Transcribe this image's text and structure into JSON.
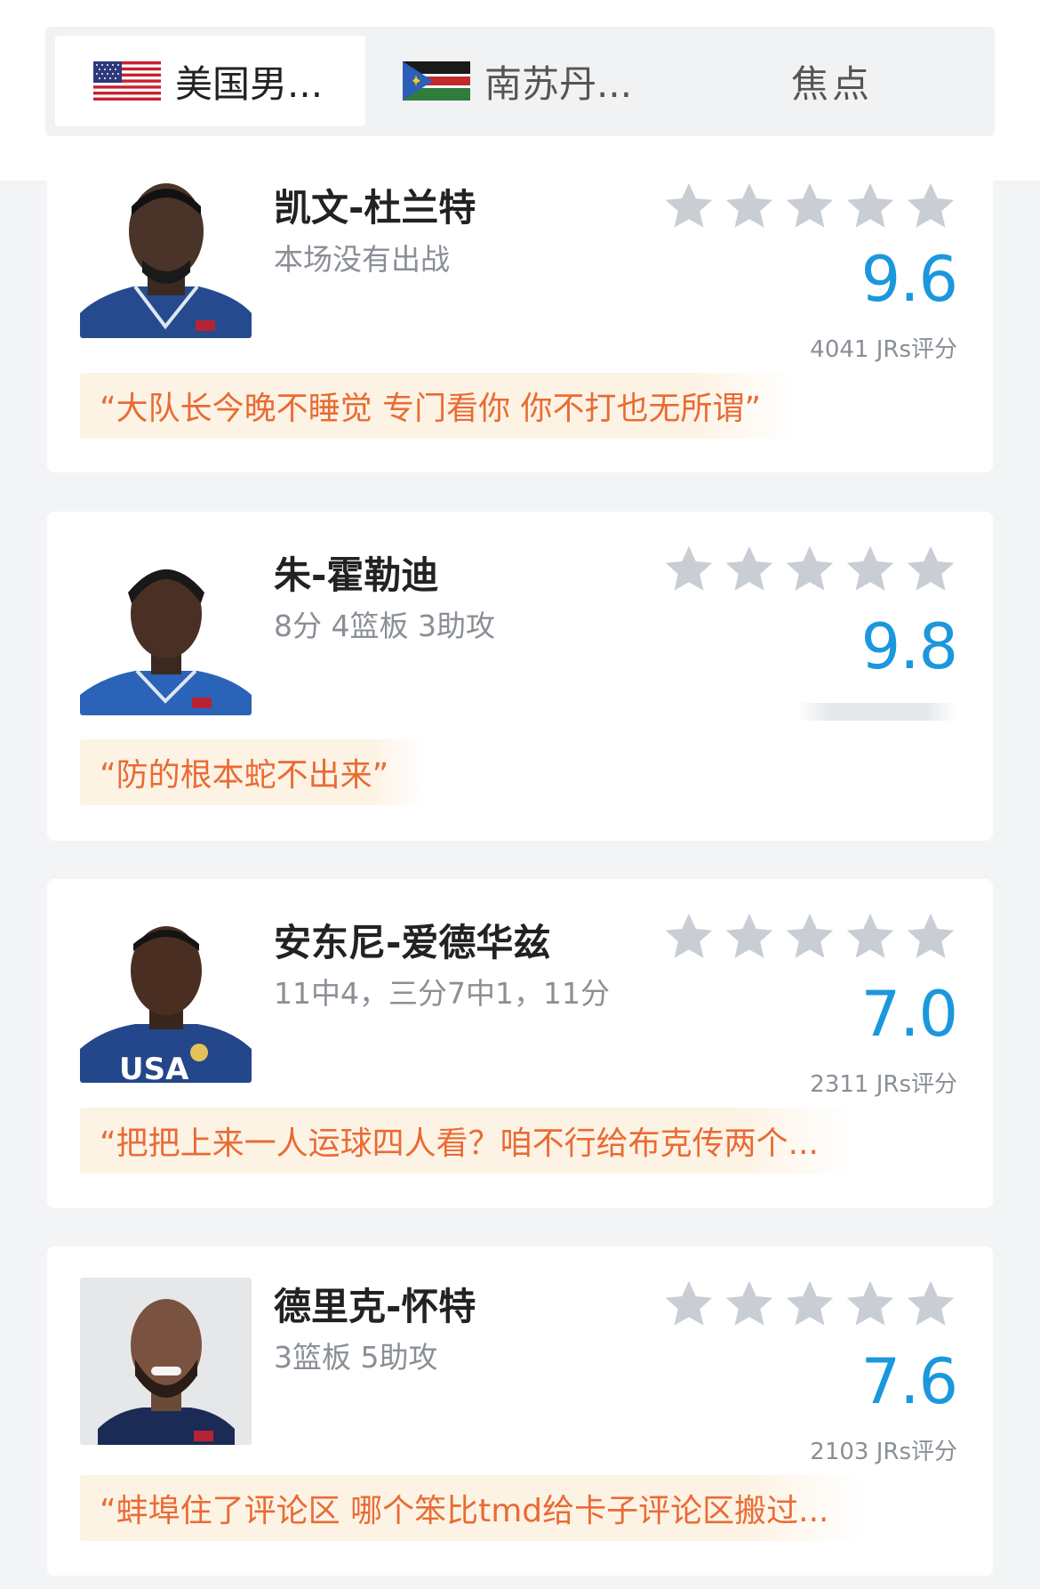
{
  "tabs": [
    {
      "label": "美国男...",
      "flag": "usa-flag",
      "active": true
    },
    {
      "label": "南苏丹...",
      "flag": "south-sudan-flag",
      "active": false
    },
    {
      "label": "焦点",
      "active": false
    }
  ],
  "players": [
    {
      "name": "凯文-杜兰特",
      "stat": "本场没有出战",
      "score": "9.6",
      "votes": "4041 JRs评分",
      "stars_filled": 0,
      "quote": "“大队长今晚不睡觉 专门看你 你不打也无所谓”"
    },
    {
      "name": "朱-霍勒迪",
      "stat": "8分 4篮板 3助攻",
      "score": "9.8",
      "votes": "",
      "stars_filled": 0,
      "quote": "“防的根本蛇不出来”"
    },
    {
      "name": "安东尼-爱德华兹",
      "stat": "11中4，三分7中1，11分",
      "score": "7.0",
      "votes": "2311 JRs评分",
      "stars_filled": 0,
      "quote": "“把把上来一人运球四人看？咱不行给布克传两个..."
    },
    {
      "name": "德里克-怀特",
      "stat": "3篮板 5助攻",
      "score": "7.6",
      "votes": "2103 JRs评分",
      "stars_filled": 0,
      "quote": "“蚌埠住了评论区 哪个笨比tmd给卡子评论区搬过..."
    }
  ],
  "colors": {
    "score": "#1b97dd",
    "quote_text": "#e96b35",
    "quote_bg": "#fdf3e4",
    "star": "#c9cdd4"
  }
}
